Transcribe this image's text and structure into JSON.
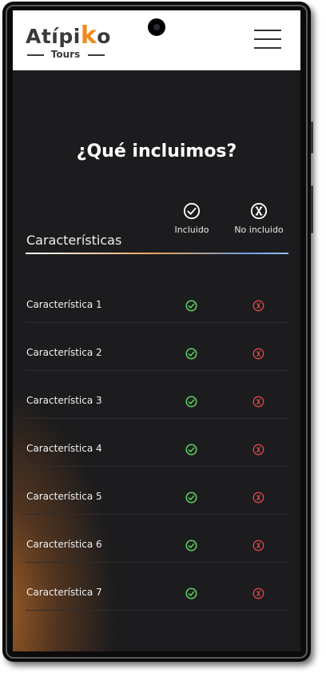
{
  "brand": {
    "name_start": "Atípi",
    "name_k": "k",
    "name_end": "o",
    "subtitle": "Tours",
    "accent": "#f08a1e"
  },
  "section_title": "¿Qué incluimos?",
  "columns": {
    "feature": "Características",
    "included": "Incluido",
    "not_included": "No incluido"
  },
  "features": [
    {
      "name": "Característica 1",
      "included": true,
      "not_included": true
    },
    {
      "name": "Característica 2",
      "included": true,
      "not_included": true
    },
    {
      "name": "Característica 3",
      "included": true,
      "not_included": true
    },
    {
      "name": "Característica 4",
      "included": true,
      "not_included": true
    },
    {
      "name": "Característica 5",
      "included": true,
      "not_included": true
    },
    {
      "name": "Característica 6",
      "included": true,
      "not_included": true
    },
    {
      "name": "Característica 7",
      "included": true,
      "not_included": true
    }
  ],
  "icons": {
    "included": "check-circle-icon",
    "not_included": "x-circle-icon",
    "menu": "hamburger-menu-icon"
  },
  "colors": {
    "background": "#1c1c1e",
    "check": "#5fd35f",
    "cross": "#e0454a"
  }
}
